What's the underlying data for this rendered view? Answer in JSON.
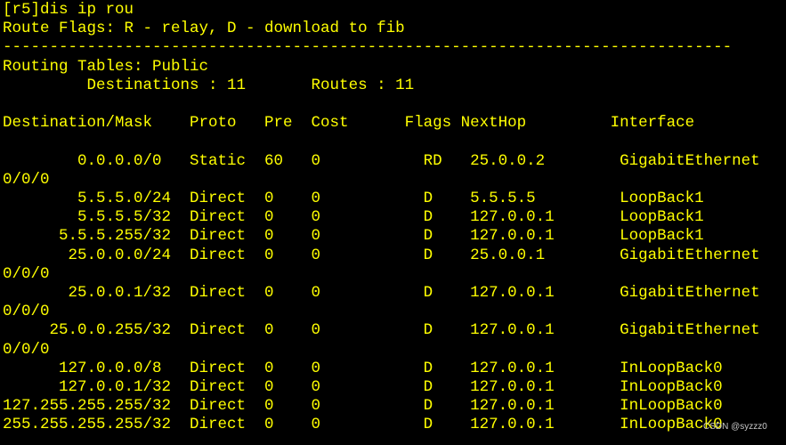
{
  "terminal": {
    "text_color": "#ffff00",
    "background_color": "#000000",
    "lines": [
      "[r5]dis ip rou",
      "Route Flags: R - relay, D - download to fib",
      "------------------------------------------------------------------------------",
      "Routing Tables: Public",
      "         Destinations : 11       Routes : 11",
      "",
      "Destination/Mask    Proto   Pre  Cost      Flags NextHop         Interface",
      "",
      "        0.0.0.0/0   Static  60   0           RD   25.0.0.2        GigabitEthernet",
      "0/0/0",
      "        5.5.5.0/24  Direct  0    0           D    5.5.5.5         LoopBack1",
      "        5.5.5.5/32  Direct  0    0           D    127.0.0.1       LoopBack1",
      "      5.5.5.255/32  Direct  0    0           D    127.0.0.1       LoopBack1",
      "       25.0.0.0/24  Direct  0    0           D    25.0.0.1        GigabitEthernet",
      "0/0/0",
      "       25.0.0.1/32  Direct  0    0           D    127.0.0.1       GigabitEthernet",
      "0/0/0",
      "     25.0.0.255/32  Direct  0    0           D    127.0.0.1       GigabitEthernet",
      "0/0/0",
      "      127.0.0.0/8   Direct  0    0           D    127.0.0.1       InLoopBack0",
      "      127.0.0.1/32  Direct  0    0           D    127.0.0.1       InLoopBack0",
      "127.255.255.255/32  Direct  0    0           D    127.0.0.1       InLoopBack0",
      "255.255.255.255/32  Direct  0    0           D    127.0.0.1       InLoopBack0"
    ]
  },
  "watermark": {
    "text": "CSDN @syzzz0"
  }
}
